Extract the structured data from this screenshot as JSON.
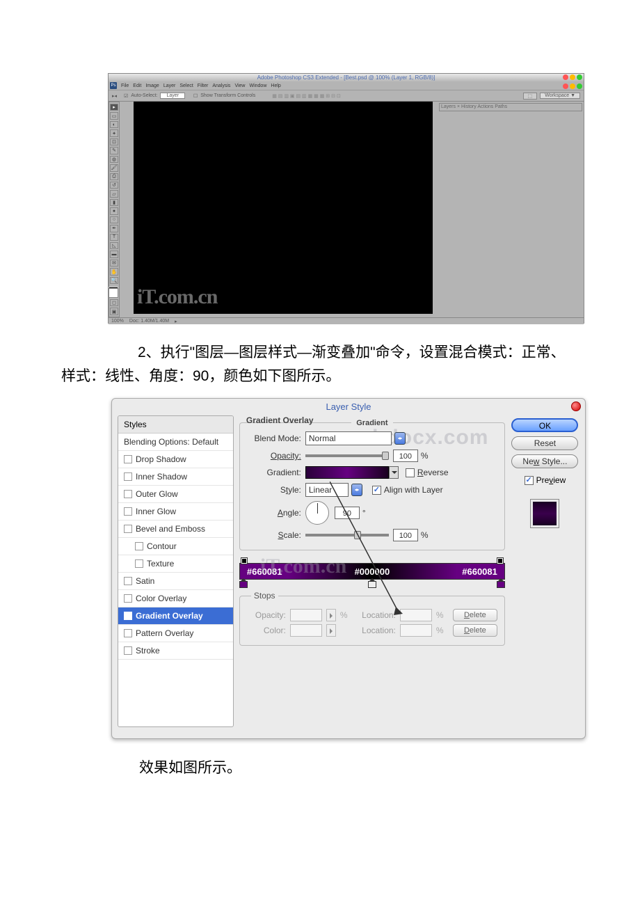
{
  "ps": {
    "title": "Adobe Photoshop CS3 Extended - [Best.psd @ 100% (Layer 1, RGB/8)]",
    "menus": [
      "File",
      "Edit",
      "Image",
      "Layer",
      "Select",
      "Filter",
      "Analysis",
      "View",
      "Window",
      "Help"
    ],
    "option_auto": "Auto-Select:",
    "option_layer": "Layer",
    "option_transform": "Show Transform Controls",
    "option_workspace": "Workspace ▼",
    "panel_tabs": "Layers × History Actions Paths",
    "status_zoom": "100%",
    "status_doc": "Doc: 1.40M/1.40M",
    "watermark": "iT.com.cn"
  },
  "article": {
    "step2": "2、执行\"图层—图层样式—渐变叠加\"命令，设置混合模式：正常、样式：线性、角度：90，颜色如下图所示。",
    "result": "效果如图所示。"
  },
  "ls": {
    "title": "Layer Style",
    "styles_header": "Styles",
    "blending": "Blending Options: Default",
    "items": {
      "drop_shadow": "Drop Shadow",
      "inner_shadow": "Inner Shadow",
      "outer_glow": "Outer Glow",
      "inner_glow": "Inner Glow",
      "bevel": "Bevel and Emboss",
      "contour": "Contour",
      "texture": "Texture",
      "satin": "Satin",
      "color_overlay": "Color Overlay",
      "gradient_overlay": "Gradient Overlay",
      "pattern_overlay": "Pattern Overlay",
      "stroke": "Stroke"
    },
    "section": "Gradient Overlay",
    "subsection": "Gradient",
    "labels": {
      "blend_mode": "Blend Mode:",
      "opacity": "Opacity:",
      "gradient": "Gradient:",
      "style": "Style:",
      "angle": "Angle:",
      "scale": "Scale:",
      "reverse": "Reverse",
      "align": "Align with Layer",
      "stops": "Stops",
      "stop_opacity": "Opacity:",
      "stop_color": "Color:",
      "location": "Location:",
      "percent": "%"
    },
    "values": {
      "blend_mode": "Normal",
      "opacity": "100",
      "style": "Linear",
      "angle": "90",
      "scale": "100"
    },
    "colors": {
      "left": "#660081",
      "mid": "#000000",
      "right": "#660081"
    },
    "buttons": {
      "ok": "OK",
      "reset": "Reset",
      "new_style": "New Style...",
      "preview": "Preview",
      "delete": "Delete"
    },
    "watermark1": "www.bdocx.com",
    "watermark2": "iT.com.cn"
  }
}
